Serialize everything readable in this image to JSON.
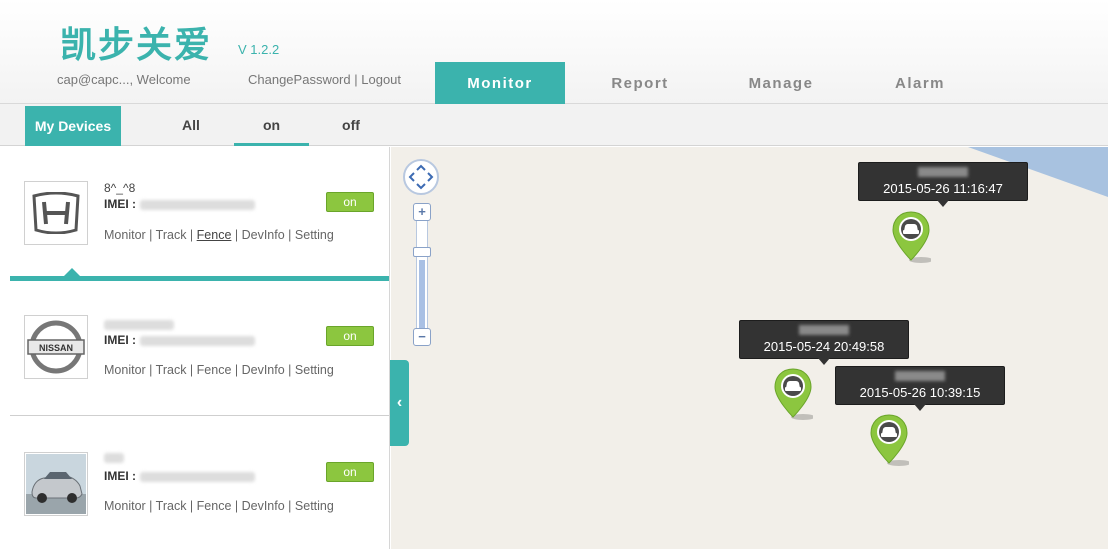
{
  "app": {
    "logo": "凯步关爱",
    "version": "V 1.2.2"
  },
  "header": {
    "welcome": "cap@capc..., Welcome",
    "change_password": "ChangePassword",
    "separator": "|",
    "logout": "Logout",
    "tabs": [
      {
        "label": "Monitor",
        "active": true
      },
      {
        "label": "Report",
        "active": false
      },
      {
        "label": "Manage",
        "active": false
      },
      {
        "label": "Alarm",
        "active": false
      }
    ]
  },
  "subbar": {
    "my_devices": "My Devices",
    "filters": [
      {
        "label": "All",
        "active": false
      },
      {
        "label": "on",
        "active": true
      },
      {
        "label": "off",
        "active": false
      }
    ]
  },
  "devices": [
    {
      "brand": "honda-logo",
      "name": "8^_^8",
      "imei_label": "IMEI :",
      "status": "on",
      "actions": [
        "Monitor",
        "Track",
        "Fence",
        "DevInfo",
        "Setting"
      ],
      "selected_action": "Fence"
    },
    {
      "brand": "nissan-logo",
      "brand_text": "NISSAN",
      "name": "",
      "imei_label": "IMEI :",
      "status": "on",
      "actions": [
        "Monitor",
        "Track",
        "Fence",
        "DevInfo",
        "Setting"
      ]
    },
    {
      "brand": "car-photo",
      "name": "",
      "imei_label": "IMEI :",
      "status": "on",
      "actions": [
        "Monitor",
        "Track",
        "Fence",
        "DevInfo",
        "Setting"
      ]
    }
  ],
  "map": {
    "markers": [
      {
        "timestamp": "2015-05-26 11:16:47"
      },
      {
        "timestamp": "2015-05-24 20:49:58"
      },
      {
        "timestamp": "2015-05-26 10:39:15"
      }
    ],
    "zoom_in": "+",
    "zoom_out": "−"
  },
  "colors": {
    "accent": "#3bb3ad",
    "status_on": "#8cc63f",
    "tooltip_bg": "#333333"
  }
}
